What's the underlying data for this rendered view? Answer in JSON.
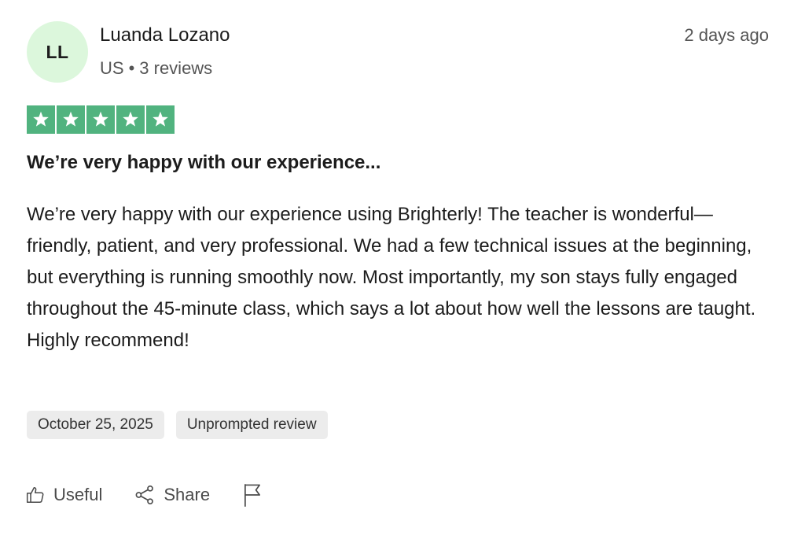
{
  "reviewer": {
    "initials": "LL",
    "name": "Luanda Lozano",
    "country": "US",
    "separator": "•",
    "reviews_count": "3 reviews"
  },
  "review": {
    "date_ago": "2 days ago",
    "rating": 5,
    "rating_max": 5,
    "star_color": "#51b37f",
    "title": "We’re very happy with our experience...",
    "body": "We’re very happy with our experience using Brighterly! The teacher is wonderful—friendly, patient, and very professional. We had a few technical issues at the beginning, but everything is running smoothly now. Most importantly, my son stays fully engaged throughout the 45-minute class, which says a lot about how well the lessons are taught. Highly recommend!",
    "tags": [
      "October 25, 2025",
      "Unprompted review"
    ]
  },
  "actions": {
    "useful_label": "Useful",
    "useful_icon": "thumbs-up-icon",
    "share_label": "Share",
    "share_icon": "share-icon",
    "report_icon": "flag-icon"
  },
  "colors": {
    "avatar_bg": "#dcf7dc",
    "tag_bg": "#ececec"
  }
}
